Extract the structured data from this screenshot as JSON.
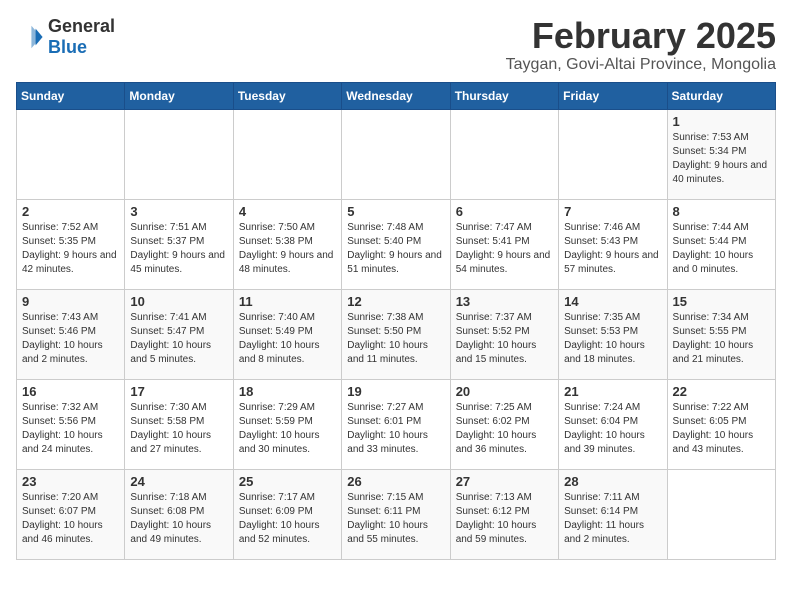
{
  "header": {
    "logo_general": "General",
    "logo_blue": "Blue",
    "month_title": "February 2025",
    "location": "Taygan, Govi-Altai Province, Mongolia"
  },
  "days_of_week": [
    "Sunday",
    "Monday",
    "Tuesday",
    "Wednesday",
    "Thursday",
    "Friday",
    "Saturday"
  ],
  "weeks": [
    [
      {
        "day": "",
        "info": ""
      },
      {
        "day": "",
        "info": ""
      },
      {
        "day": "",
        "info": ""
      },
      {
        "day": "",
        "info": ""
      },
      {
        "day": "",
        "info": ""
      },
      {
        "day": "",
        "info": ""
      },
      {
        "day": "1",
        "info": "Sunrise: 7:53 AM\nSunset: 5:34 PM\nDaylight: 9 hours and 40 minutes."
      }
    ],
    [
      {
        "day": "2",
        "info": "Sunrise: 7:52 AM\nSunset: 5:35 PM\nDaylight: 9 hours and 42 minutes."
      },
      {
        "day": "3",
        "info": "Sunrise: 7:51 AM\nSunset: 5:37 PM\nDaylight: 9 hours and 45 minutes."
      },
      {
        "day": "4",
        "info": "Sunrise: 7:50 AM\nSunset: 5:38 PM\nDaylight: 9 hours and 48 minutes."
      },
      {
        "day": "5",
        "info": "Sunrise: 7:48 AM\nSunset: 5:40 PM\nDaylight: 9 hours and 51 minutes."
      },
      {
        "day": "6",
        "info": "Sunrise: 7:47 AM\nSunset: 5:41 PM\nDaylight: 9 hours and 54 minutes."
      },
      {
        "day": "7",
        "info": "Sunrise: 7:46 AM\nSunset: 5:43 PM\nDaylight: 9 hours and 57 minutes."
      },
      {
        "day": "8",
        "info": "Sunrise: 7:44 AM\nSunset: 5:44 PM\nDaylight: 10 hours and 0 minutes."
      }
    ],
    [
      {
        "day": "9",
        "info": "Sunrise: 7:43 AM\nSunset: 5:46 PM\nDaylight: 10 hours and 2 minutes."
      },
      {
        "day": "10",
        "info": "Sunrise: 7:41 AM\nSunset: 5:47 PM\nDaylight: 10 hours and 5 minutes."
      },
      {
        "day": "11",
        "info": "Sunrise: 7:40 AM\nSunset: 5:49 PM\nDaylight: 10 hours and 8 minutes."
      },
      {
        "day": "12",
        "info": "Sunrise: 7:38 AM\nSunset: 5:50 PM\nDaylight: 10 hours and 11 minutes."
      },
      {
        "day": "13",
        "info": "Sunrise: 7:37 AM\nSunset: 5:52 PM\nDaylight: 10 hours and 15 minutes."
      },
      {
        "day": "14",
        "info": "Sunrise: 7:35 AM\nSunset: 5:53 PM\nDaylight: 10 hours and 18 minutes."
      },
      {
        "day": "15",
        "info": "Sunrise: 7:34 AM\nSunset: 5:55 PM\nDaylight: 10 hours and 21 minutes."
      }
    ],
    [
      {
        "day": "16",
        "info": "Sunrise: 7:32 AM\nSunset: 5:56 PM\nDaylight: 10 hours and 24 minutes."
      },
      {
        "day": "17",
        "info": "Sunrise: 7:30 AM\nSunset: 5:58 PM\nDaylight: 10 hours and 27 minutes."
      },
      {
        "day": "18",
        "info": "Sunrise: 7:29 AM\nSunset: 5:59 PM\nDaylight: 10 hours and 30 minutes."
      },
      {
        "day": "19",
        "info": "Sunrise: 7:27 AM\nSunset: 6:01 PM\nDaylight: 10 hours and 33 minutes."
      },
      {
        "day": "20",
        "info": "Sunrise: 7:25 AM\nSunset: 6:02 PM\nDaylight: 10 hours and 36 minutes."
      },
      {
        "day": "21",
        "info": "Sunrise: 7:24 AM\nSunset: 6:04 PM\nDaylight: 10 hours and 39 minutes."
      },
      {
        "day": "22",
        "info": "Sunrise: 7:22 AM\nSunset: 6:05 PM\nDaylight: 10 hours and 43 minutes."
      }
    ],
    [
      {
        "day": "23",
        "info": "Sunrise: 7:20 AM\nSunset: 6:07 PM\nDaylight: 10 hours and 46 minutes."
      },
      {
        "day": "24",
        "info": "Sunrise: 7:18 AM\nSunset: 6:08 PM\nDaylight: 10 hours and 49 minutes."
      },
      {
        "day": "25",
        "info": "Sunrise: 7:17 AM\nSunset: 6:09 PM\nDaylight: 10 hours and 52 minutes."
      },
      {
        "day": "26",
        "info": "Sunrise: 7:15 AM\nSunset: 6:11 PM\nDaylight: 10 hours and 55 minutes."
      },
      {
        "day": "27",
        "info": "Sunrise: 7:13 AM\nSunset: 6:12 PM\nDaylight: 10 hours and 59 minutes."
      },
      {
        "day": "28",
        "info": "Sunrise: 7:11 AM\nSunset: 6:14 PM\nDaylight: 11 hours and 2 minutes."
      },
      {
        "day": "",
        "info": ""
      }
    ]
  ]
}
